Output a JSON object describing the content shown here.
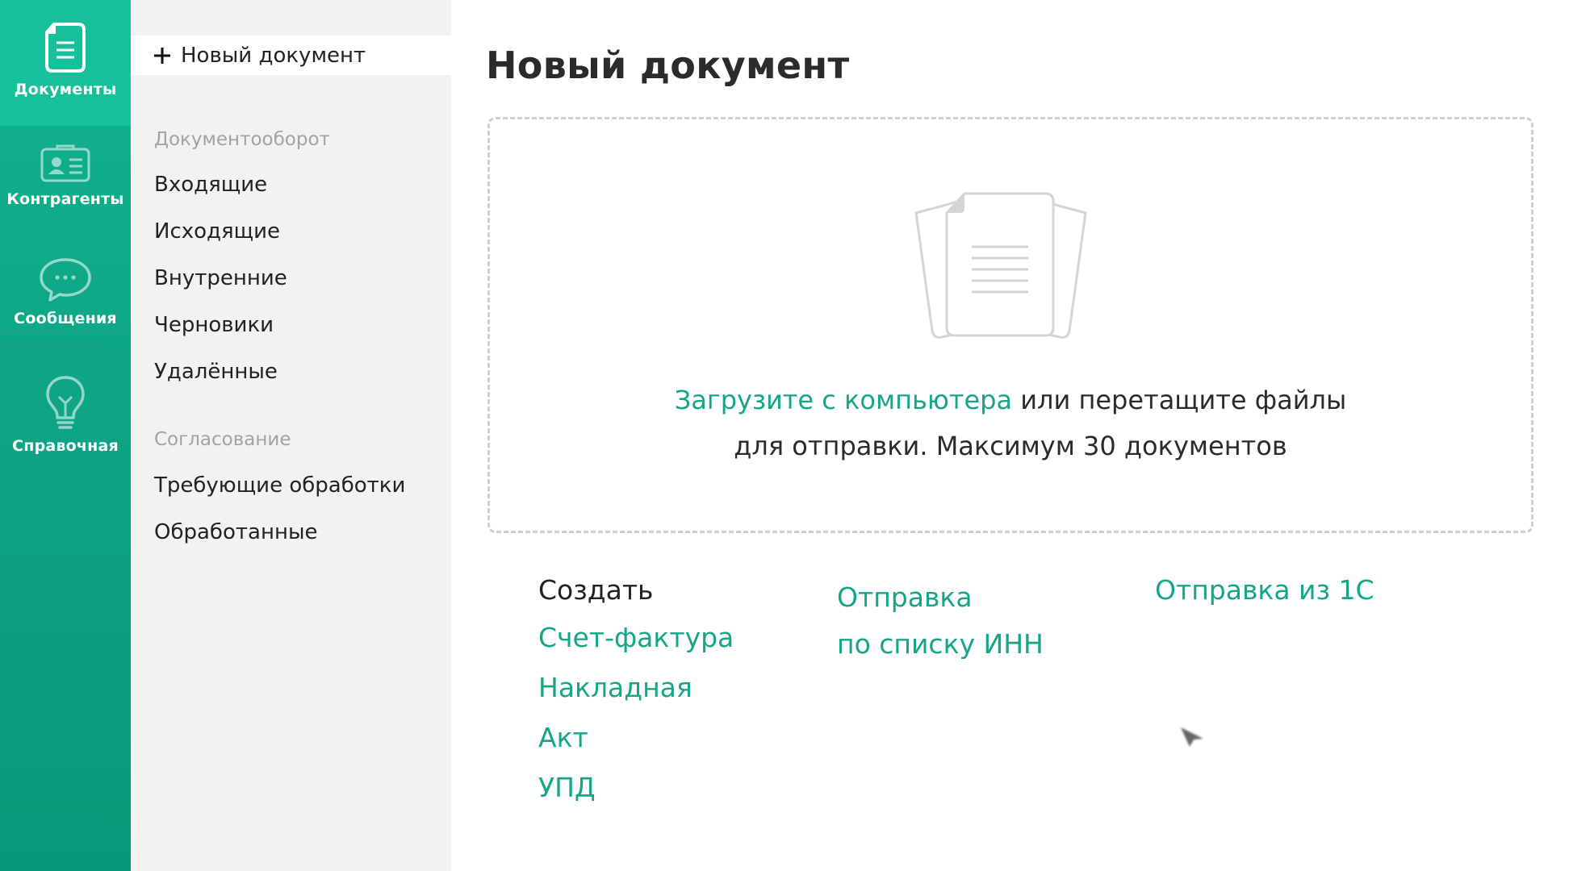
{
  "rail": {
    "items": [
      {
        "label": "Документы",
        "icon": "document-icon",
        "active": true
      },
      {
        "label": "Контрагенты",
        "icon": "contact-card-icon",
        "active": false
      },
      {
        "label": "Сообщения",
        "icon": "chat-bubble-icon",
        "active": false
      },
      {
        "label": "Справочная",
        "icon": "lightbulb-icon",
        "active": false
      }
    ]
  },
  "sidebar": {
    "new_document_label": "Новый документ",
    "sections": [
      {
        "title": "Документооборот",
        "items": [
          "Входящие",
          "Исходящие",
          "Внутренние",
          "Черновики",
          "Удалённые"
        ]
      },
      {
        "title": "Согласование",
        "items": [
          "Требующие обработки",
          "Обработанные"
        ]
      }
    ]
  },
  "main": {
    "title": "Новый документ",
    "dropzone": {
      "upload_link": "Загрузите с компьютера",
      "text_after_link": " или перетащите файлы",
      "second_line": "для отправки. Максимум 30 документов"
    },
    "create": {
      "title": "Создать",
      "links": [
        "Счет-фактура",
        "Накладная",
        "Акт",
        "УПД"
      ]
    },
    "send_by_inn": {
      "line1": "Отправка",
      "line2": "по списку ИНН"
    },
    "send_from_1c": "Отправка из 1С"
  },
  "colors": {
    "rail_top": "#12b38f",
    "rail_active": "#16c09b",
    "accent": "#16a587",
    "sidebar_bg": "#f2f2f2",
    "muted_text": "#a3a3a3"
  }
}
